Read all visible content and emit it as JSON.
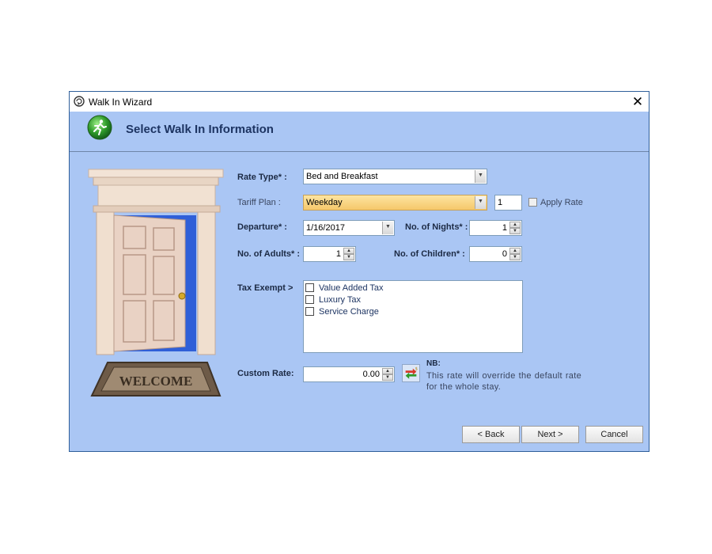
{
  "window": {
    "title": "Walk In Wizard",
    "close_symbol": "✕"
  },
  "header": {
    "title": "Select Walk In Information"
  },
  "form": {
    "rate_type": {
      "label": "Rate Type* :",
      "value": "Bed and Breakfast"
    },
    "tariff_plan": {
      "label": "Tariff Plan :",
      "value": "Weekday",
      "qty": "1",
      "apply_rate_label": "Apply Rate"
    },
    "departure": {
      "label": "Departure* :",
      "value": "1/16/2017"
    },
    "nights": {
      "label": "No. of Nights* :",
      "value": "1"
    },
    "adults": {
      "label": "No. of Adults* :",
      "value": "1"
    },
    "children": {
      "label": "No. of Children* :",
      "value": "0"
    },
    "tax_exempt": {
      "label": "Tax Exempt >",
      "items": [
        {
          "label": "Value Added Tax",
          "checked": false
        },
        {
          "label": "Luxury Tax",
          "checked": false
        },
        {
          "label": "Service Charge",
          "checked": false
        }
      ]
    },
    "custom_rate": {
      "label": "Custom Rate:",
      "value": "0.00"
    },
    "note": {
      "title": "NB:",
      "text": "This rate will override the default rate for the whole stay."
    }
  },
  "illustration": {
    "mat_text": "WELCOME"
  },
  "buttons": {
    "back": "< Back",
    "next": "Next >",
    "cancel": "Cancel"
  }
}
